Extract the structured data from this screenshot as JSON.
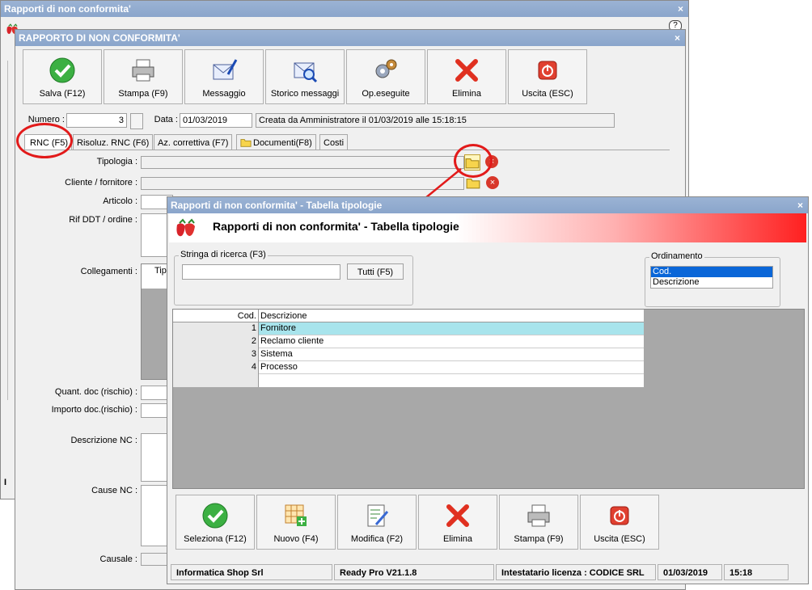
{
  "back_window": {
    "title": "Rapporti di non conformita'",
    "close": "×",
    "help": "?"
  },
  "main_window": {
    "title": "RAPPORTO DI NON CONFORMITA'",
    "close": "×",
    "toolbar": [
      {
        "label": "Salva (F12)",
        "icon": "check-icon"
      },
      {
        "label": "Stampa (F9)",
        "icon": "printer-icon"
      },
      {
        "label": "Messaggio",
        "icon": "envelope-pen-icon"
      },
      {
        "label": "Storico messaggi",
        "icon": "envelope-search-icon"
      },
      {
        "label": "Op.eseguite",
        "icon": "gears-icon"
      },
      {
        "label": "Elimina",
        "icon": "red-x-icon"
      },
      {
        "label": "Uscita (ESC)",
        "icon": "power-icon"
      }
    ],
    "numero_label": "Numero :",
    "numero_value": "3",
    "data_label": "Data :",
    "data_value": "01/03/2019",
    "created_info": "Creata da Amministratore il 01/03/2019 alle 15:18:15",
    "tabs": [
      "RNC (F5)",
      "Risoluz. RNC (F6)",
      "Az. correttiva (F7)",
      "Documenti(F8)",
      "Costi"
    ],
    "labels": {
      "tipologia": "Tipologia :",
      "cliente": "Cliente / fornitore :",
      "articolo": "Articolo :",
      "rif_ddt": "Rif DDT / ordine :",
      "collegamenti": "Collegamenti :",
      "quant": "Quant. doc (rischio) :",
      "importo": "Importo doc.(rischio) :",
      "descrizione": "Descrizione NC :",
      "cause": "Cause NC :",
      "causale": "Causale :"
    },
    "collegamenti_header": "Tipo"
  },
  "dialog": {
    "title": "Rapporti di non conformita' - Tabella tipologie",
    "close": "×",
    "header": "Rapporti di non conformita' - Tabella tipologie",
    "search_group": "Stringa di ricerca (F3)",
    "search_value": "",
    "tutti_button": "Tutti (F5)",
    "order_group": "Ordinamento",
    "order_options": [
      "Cod.",
      "Descrizione"
    ],
    "grid_headers": [
      "Cod.",
      "Descrizione"
    ],
    "rows": [
      {
        "cod": "1",
        "desc": "Fornitore"
      },
      {
        "cod": "2",
        "desc": "Reclamo cliente"
      },
      {
        "cod": "3",
        "desc": "Sistema"
      },
      {
        "cod": "4",
        "desc": "Processo"
      }
    ],
    "toolbar": [
      {
        "label": "Seleziona (F12)",
        "icon": "check-icon"
      },
      {
        "label": "Nuovo (F4)",
        "icon": "grid-add-icon"
      },
      {
        "label": "Modifica (F2)",
        "icon": "doc-edit-icon"
      },
      {
        "label": "Elimina",
        "icon": "red-x-icon"
      },
      {
        "label": "Stampa (F9)",
        "icon": "printer-icon"
      },
      {
        "label": "Uscita (ESC)",
        "icon": "power-icon"
      }
    ],
    "status": [
      "Informatica Shop Srl",
      "Ready Pro V21.1.8",
      "Intestatario licenza : CODICE SRL",
      "01/03/2019",
      "15:18"
    ]
  }
}
